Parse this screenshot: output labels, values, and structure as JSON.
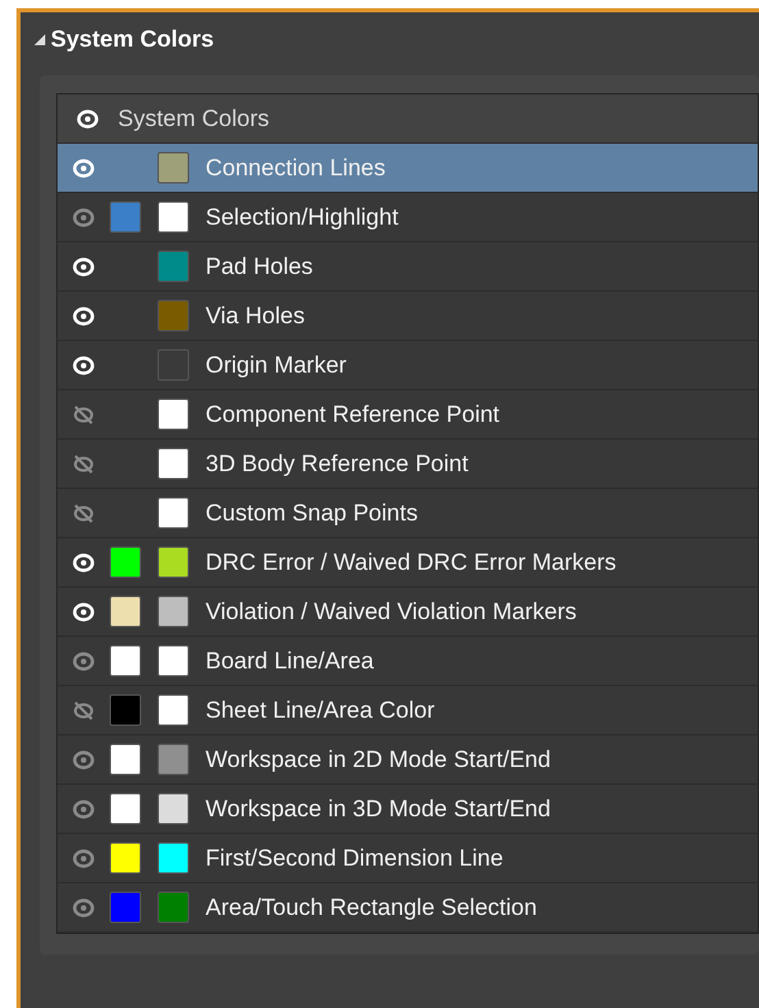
{
  "panel": {
    "title": "System Colors",
    "expanded": true
  },
  "table": {
    "header": {
      "label": "System Colors",
      "visible": true,
      "dimmed": false
    },
    "rows": [
      {
        "label": "Connection Lines",
        "visible": true,
        "dimmed": false,
        "selected": true,
        "swatches": [
          {
            "color": "#9ea07a"
          }
        ]
      },
      {
        "label": "Selection/Highlight",
        "visible": true,
        "dimmed": true,
        "selected": false,
        "swatches": [
          {
            "color": "#3a7fc8"
          },
          {
            "color": "#ffffff"
          }
        ]
      },
      {
        "label": "Pad Holes",
        "visible": true,
        "dimmed": false,
        "selected": false,
        "swatches": [
          {
            "color": "#008b8b"
          }
        ]
      },
      {
        "label": "Via Holes",
        "visible": true,
        "dimmed": false,
        "selected": false,
        "swatches": [
          {
            "color": "#7a5c00"
          }
        ]
      },
      {
        "label": "Origin Marker",
        "visible": true,
        "dimmed": false,
        "selected": false,
        "swatches": [
          {
            "color": "#3a3a3a"
          }
        ]
      },
      {
        "label": "Component Reference Point",
        "visible": false,
        "dimmed": true,
        "selected": false,
        "swatches": [
          {
            "color": "#ffffff"
          }
        ]
      },
      {
        "label": "3D Body Reference Point",
        "visible": false,
        "dimmed": true,
        "selected": false,
        "swatches": [
          {
            "color": "#ffffff"
          }
        ]
      },
      {
        "label": "Custom Snap Points",
        "visible": false,
        "dimmed": true,
        "selected": false,
        "swatches": [
          {
            "color": "#ffffff"
          }
        ]
      },
      {
        "label": "DRC Error / Waived DRC Error Markers",
        "visible": true,
        "dimmed": false,
        "selected": false,
        "swatches": [
          {
            "color": "#00ff00"
          },
          {
            "color": "#aadd22"
          }
        ]
      },
      {
        "label": "Violation / Waived Violation Markers",
        "visible": true,
        "dimmed": false,
        "selected": false,
        "swatches": [
          {
            "color": "#eedfae"
          },
          {
            "color": "#bdbdbd"
          }
        ]
      },
      {
        "label": "Board Line/Area",
        "visible": true,
        "dimmed": true,
        "selected": false,
        "swatches": [
          {
            "color": "#ffffff"
          },
          {
            "color": "#ffffff"
          }
        ]
      },
      {
        "label": "Sheet Line/Area Color",
        "visible": false,
        "dimmed": true,
        "selected": false,
        "swatches": [
          {
            "color": "#000000"
          },
          {
            "color": "#ffffff"
          }
        ]
      },
      {
        "label": "Workspace in 2D Mode Start/End",
        "visible": true,
        "dimmed": true,
        "selected": false,
        "swatches": [
          {
            "color": "#ffffff"
          },
          {
            "color": "#8f8f8f"
          }
        ]
      },
      {
        "label": "Workspace in 3D Mode Start/End",
        "visible": true,
        "dimmed": true,
        "selected": false,
        "swatches": [
          {
            "color": "#ffffff"
          },
          {
            "color": "#dcdcdc"
          }
        ]
      },
      {
        "label": "First/Second Dimension Line",
        "visible": true,
        "dimmed": true,
        "selected": false,
        "swatches": [
          {
            "color": "#ffff00"
          },
          {
            "color": "#00ffff"
          }
        ]
      },
      {
        "label": "Area/Touch Rectangle Selection",
        "visible": true,
        "dimmed": true,
        "selected": false,
        "swatches": [
          {
            "color": "#0000ff"
          },
          {
            "color": "#008000"
          }
        ]
      }
    ]
  }
}
